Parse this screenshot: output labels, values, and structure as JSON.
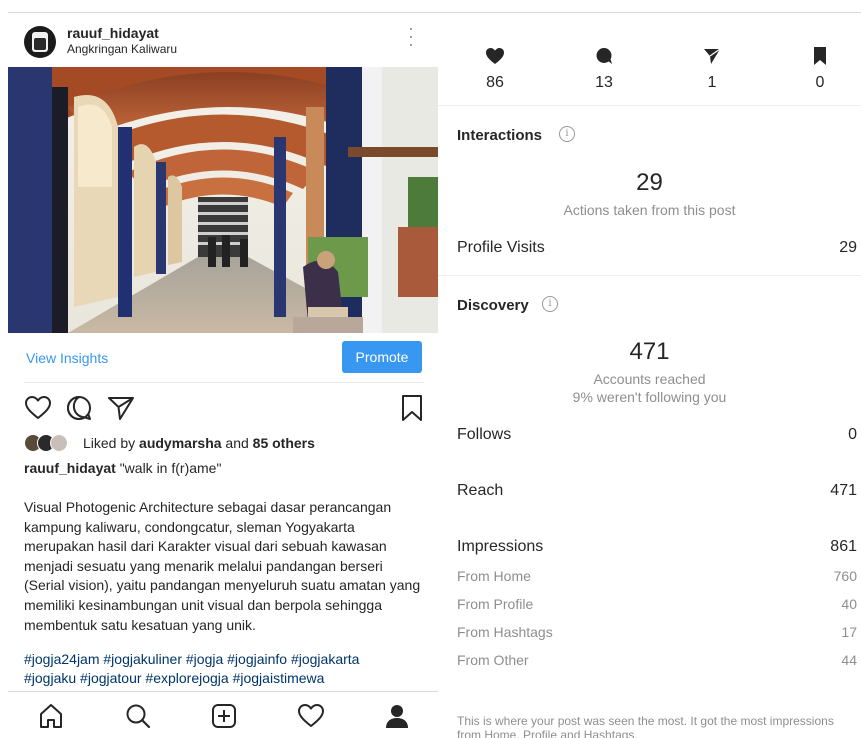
{
  "post": {
    "username": "rauuf_hidayat",
    "location": "Angkringan Kaliwaru",
    "view_insights": "View Insights",
    "promote": "Promote",
    "likes_prefix": "Liked by ",
    "likes_user": "audymarsha",
    "likes_and": " and ",
    "likes_others": "85 others",
    "caption_user": "rauuf_hidayat",
    "caption_text": " \"walk in f(r)ame\"",
    "description": "Visual Photogenic Architecture sebagai dasar perancangan kampung kaliwaru, condongcatur, sleman Yogyakarta merupakan hasil dari Karakter visual dari sebuah kawasan menjadi sesuatu yang menarik melalui pandangan berseri (Serial vision), yaitu pandangan menyeluruh suatu amatan yang memiliki kesinambungan unit visual dan berpola sehingga membentuk satu kesatuan yang unik.",
    "hashtags_line1": "#jogja24jam #jogjakuliner #jogja #jogjainfo #jogjakarta",
    "hashtags_line2": "#jogjaku #jogjatour #explorejogja #jogjaistimewa",
    "accent_color": "#3897f0",
    "hashtag_color": "#003569"
  },
  "action_icons": [
    "heart-outline-icon",
    "comment-outline-icon",
    "share-paper-plane-icon",
    "bookmark-outline-icon"
  ],
  "nav_icons": [
    "home-icon",
    "search-icon",
    "new-post-icon",
    "activity-heart-icon",
    "profile-icon"
  ],
  "insights": {
    "stats": [
      {
        "icon": "heart-icon",
        "value": "86"
      },
      {
        "icon": "comment-icon",
        "value": "13"
      },
      {
        "icon": "share-icon",
        "value": "1"
      },
      {
        "icon": "bookmark-icon",
        "value": "0"
      }
    ],
    "interactions": {
      "title": "Interactions",
      "count": "29",
      "subtitle": "Actions taken from this post",
      "profile_visits_label": "Profile Visits",
      "profile_visits_value": "29"
    },
    "discovery": {
      "title": "Discovery",
      "count": "471",
      "subtitle1": "Accounts reached",
      "subtitle2": "9% weren't following you",
      "follows_label": "Follows",
      "follows_value": "0",
      "reach_label": "Reach",
      "reach_value": "471",
      "impressions_label": "Impressions",
      "impressions_value": "861",
      "sources": [
        {
          "label": "From Home",
          "value": "760"
        },
        {
          "label": "From Profile",
          "value": "40"
        },
        {
          "label": "From Hashtags",
          "value": "17"
        },
        {
          "label": "From Other",
          "value": "44"
        }
      ]
    },
    "footnote": "This is where your post was seen the most. It got the most impressions from Home, Profile and Hashtags."
  }
}
